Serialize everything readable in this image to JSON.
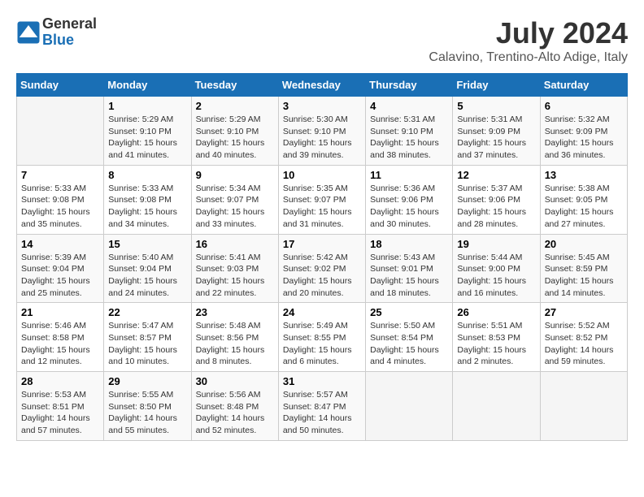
{
  "header": {
    "logo_line1": "General",
    "logo_line2": "Blue",
    "month_year": "July 2024",
    "location": "Calavino, Trentino-Alto Adige, Italy"
  },
  "weekdays": [
    "Sunday",
    "Monday",
    "Tuesday",
    "Wednesday",
    "Thursday",
    "Friday",
    "Saturday"
  ],
  "weeks": [
    [
      {
        "day": "",
        "sunrise": "",
        "sunset": "",
        "daylight": ""
      },
      {
        "day": "1",
        "sunrise": "Sunrise: 5:29 AM",
        "sunset": "Sunset: 9:10 PM",
        "daylight": "Daylight: 15 hours and 41 minutes."
      },
      {
        "day": "2",
        "sunrise": "Sunrise: 5:29 AM",
        "sunset": "Sunset: 9:10 PM",
        "daylight": "Daylight: 15 hours and 40 minutes."
      },
      {
        "day": "3",
        "sunrise": "Sunrise: 5:30 AM",
        "sunset": "Sunset: 9:10 PM",
        "daylight": "Daylight: 15 hours and 39 minutes."
      },
      {
        "day": "4",
        "sunrise": "Sunrise: 5:31 AM",
        "sunset": "Sunset: 9:10 PM",
        "daylight": "Daylight: 15 hours and 38 minutes."
      },
      {
        "day": "5",
        "sunrise": "Sunrise: 5:31 AM",
        "sunset": "Sunset: 9:09 PM",
        "daylight": "Daylight: 15 hours and 37 minutes."
      },
      {
        "day": "6",
        "sunrise": "Sunrise: 5:32 AM",
        "sunset": "Sunset: 9:09 PM",
        "daylight": "Daylight: 15 hours and 36 minutes."
      }
    ],
    [
      {
        "day": "7",
        "sunrise": "Sunrise: 5:33 AM",
        "sunset": "Sunset: 9:08 PM",
        "daylight": "Daylight: 15 hours and 35 minutes."
      },
      {
        "day": "8",
        "sunrise": "Sunrise: 5:33 AM",
        "sunset": "Sunset: 9:08 PM",
        "daylight": "Daylight: 15 hours and 34 minutes."
      },
      {
        "day": "9",
        "sunrise": "Sunrise: 5:34 AM",
        "sunset": "Sunset: 9:07 PM",
        "daylight": "Daylight: 15 hours and 33 minutes."
      },
      {
        "day": "10",
        "sunrise": "Sunrise: 5:35 AM",
        "sunset": "Sunset: 9:07 PM",
        "daylight": "Daylight: 15 hours and 31 minutes."
      },
      {
        "day": "11",
        "sunrise": "Sunrise: 5:36 AM",
        "sunset": "Sunset: 9:06 PM",
        "daylight": "Daylight: 15 hours and 30 minutes."
      },
      {
        "day": "12",
        "sunrise": "Sunrise: 5:37 AM",
        "sunset": "Sunset: 9:06 PM",
        "daylight": "Daylight: 15 hours and 28 minutes."
      },
      {
        "day": "13",
        "sunrise": "Sunrise: 5:38 AM",
        "sunset": "Sunset: 9:05 PM",
        "daylight": "Daylight: 15 hours and 27 minutes."
      }
    ],
    [
      {
        "day": "14",
        "sunrise": "Sunrise: 5:39 AM",
        "sunset": "Sunset: 9:04 PM",
        "daylight": "Daylight: 15 hours and 25 minutes."
      },
      {
        "day": "15",
        "sunrise": "Sunrise: 5:40 AM",
        "sunset": "Sunset: 9:04 PM",
        "daylight": "Daylight: 15 hours and 24 minutes."
      },
      {
        "day": "16",
        "sunrise": "Sunrise: 5:41 AM",
        "sunset": "Sunset: 9:03 PM",
        "daylight": "Daylight: 15 hours and 22 minutes."
      },
      {
        "day": "17",
        "sunrise": "Sunrise: 5:42 AM",
        "sunset": "Sunset: 9:02 PM",
        "daylight": "Daylight: 15 hours and 20 minutes."
      },
      {
        "day": "18",
        "sunrise": "Sunrise: 5:43 AM",
        "sunset": "Sunset: 9:01 PM",
        "daylight": "Daylight: 15 hours and 18 minutes."
      },
      {
        "day": "19",
        "sunrise": "Sunrise: 5:44 AM",
        "sunset": "Sunset: 9:00 PM",
        "daylight": "Daylight: 15 hours and 16 minutes."
      },
      {
        "day": "20",
        "sunrise": "Sunrise: 5:45 AM",
        "sunset": "Sunset: 8:59 PM",
        "daylight": "Daylight: 15 hours and 14 minutes."
      }
    ],
    [
      {
        "day": "21",
        "sunrise": "Sunrise: 5:46 AM",
        "sunset": "Sunset: 8:58 PM",
        "daylight": "Daylight: 15 hours and 12 minutes."
      },
      {
        "day": "22",
        "sunrise": "Sunrise: 5:47 AM",
        "sunset": "Sunset: 8:57 PM",
        "daylight": "Daylight: 15 hours and 10 minutes."
      },
      {
        "day": "23",
        "sunrise": "Sunrise: 5:48 AM",
        "sunset": "Sunset: 8:56 PM",
        "daylight": "Daylight: 15 hours and 8 minutes."
      },
      {
        "day": "24",
        "sunrise": "Sunrise: 5:49 AM",
        "sunset": "Sunset: 8:55 PM",
        "daylight": "Daylight: 15 hours and 6 minutes."
      },
      {
        "day": "25",
        "sunrise": "Sunrise: 5:50 AM",
        "sunset": "Sunset: 8:54 PM",
        "daylight": "Daylight: 15 hours and 4 minutes."
      },
      {
        "day": "26",
        "sunrise": "Sunrise: 5:51 AM",
        "sunset": "Sunset: 8:53 PM",
        "daylight": "Daylight: 15 hours and 2 minutes."
      },
      {
        "day": "27",
        "sunrise": "Sunrise: 5:52 AM",
        "sunset": "Sunset: 8:52 PM",
        "daylight": "Daylight: 14 hours and 59 minutes."
      }
    ],
    [
      {
        "day": "28",
        "sunrise": "Sunrise: 5:53 AM",
        "sunset": "Sunset: 8:51 PM",
        "daylight": "Daylight: 14 hours and 57 minutes."
      },
      {
        "day": "29",
        "sunrise": "Sunrise: 5:55 AM",
        "sunset": "Sunset: 8:50 PM",
        "daylight": "Daylight: 14 hours and 55 minutes."
      },
      {
        "day": "30",
        "sunrise": "Sunrise: 5:56 AM",
        "sunset": "Sunset: 8:48 PM",
        "daylight": "Daylight: 14 hours and 52 minutes."
      },
      {
        "day": "31",
        "sunrise": "Sunrise: 5:57 AM",
        "sunset": "Sunset: 8:47 PM",
        "daylight": "Daylight: 14 hours and 50 minutes."
      },
      {
        "day": "",
        "sunrise": "",
        "sunset": "",
        "daylight": ""
      },
      {
        "day": "",
        "sunrise": "",
        "sunset": "",
        "daylight": ""
      },
      {
        "day": "",
        "sunrise": "",
        "sunset": "",
        "daylight": ""
      }
    ]
  ]
}
